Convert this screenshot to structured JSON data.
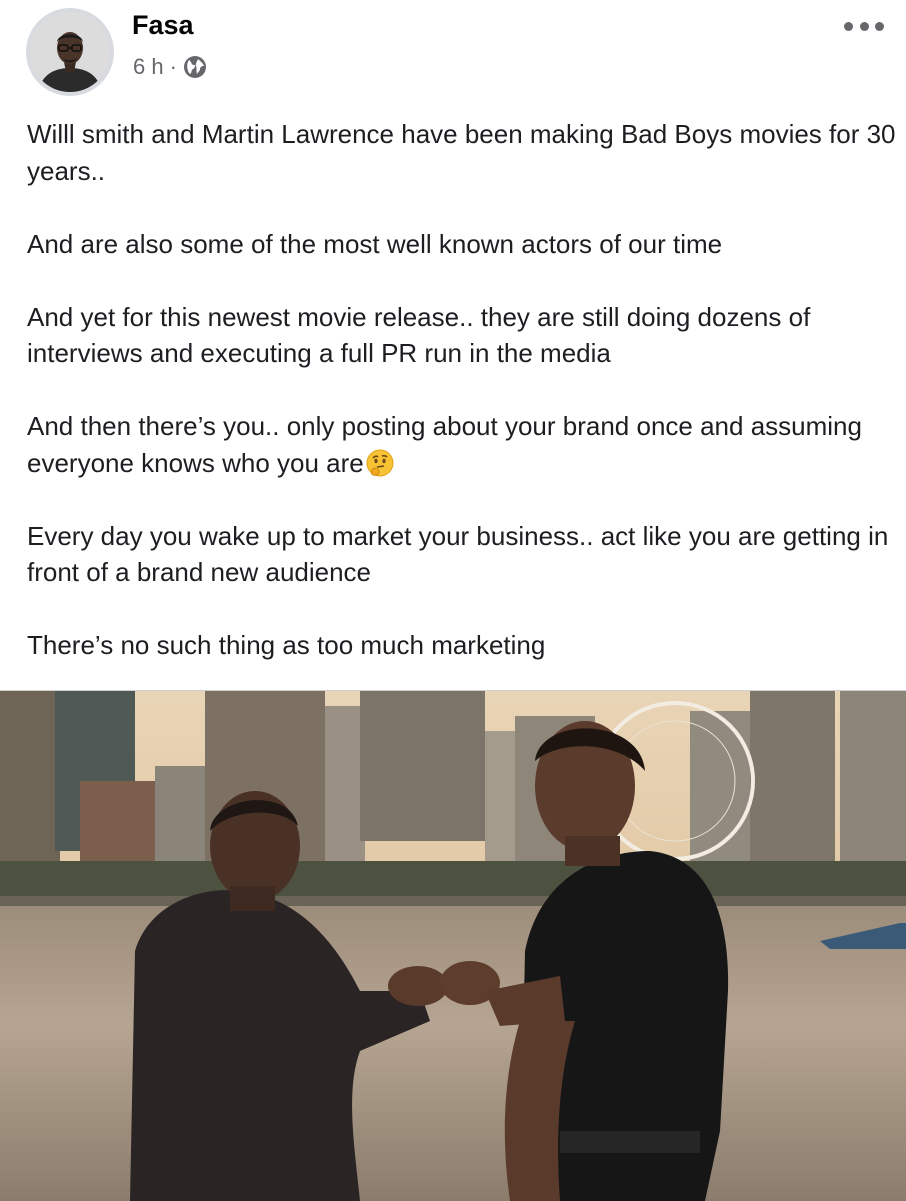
{
  "post": {
    "author": "Fasa",
    "time": "6 h",
    "separator": "·",
    "audience_icon": "globe-icon",
    "more_icon": "more-options-icon",
    "paragraphs": [
      "Willl smith and Martin Lawrence have been making Bad Boys movies for 30 years..",
      "And are also some of the most well known actors of our time",
      "And yet for this newest movie release.. they are still doing dozens of interviews and executing a full PR run in the media",
      "And then there’s you.. only posting about your brand once and assuming everyone knows who you are",
      "Every day you wake up to market your business.. act like you are getting in front of a brand new audience",
      "There’s no such thing as too much marketing"
    ],
    "emoji_after_paragraph_4": "thinking-face-emoji"
  },
  "colors": {
    "text": "#1c1e21",
    "meta": "#65676b",
    "background": "#ffffff"
  }
}
